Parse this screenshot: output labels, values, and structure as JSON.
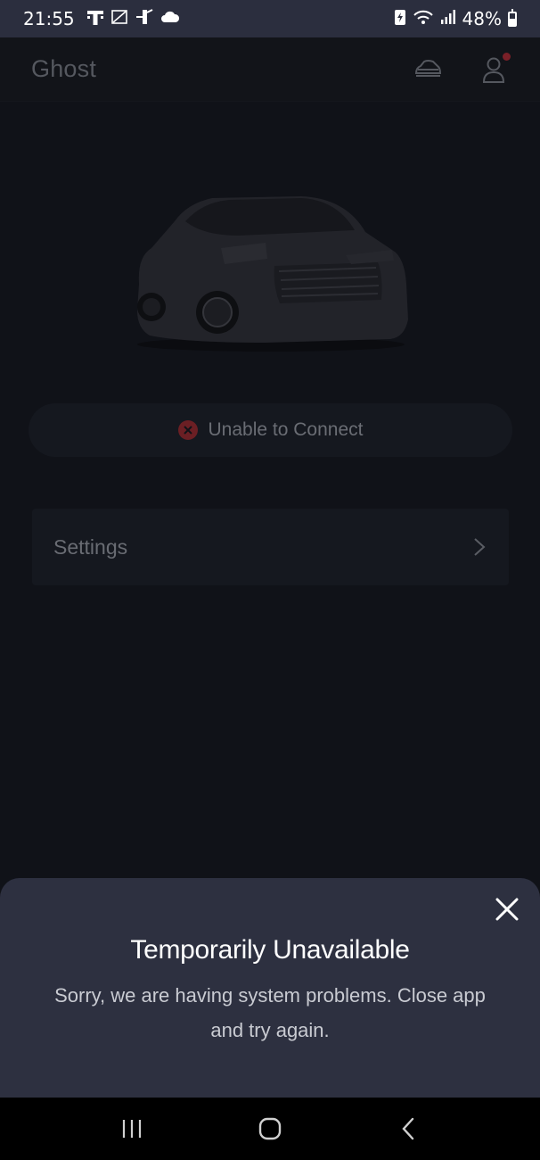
{
  "status_bar": {
    "time": "21:55",
    "left_icons": [
      "t-mobile-icon",
      "no-sim-icon",
      "usb-debug-icon",
      "cloud-icon"
    ],
    "right_icons": [
      "battery-saver-icon",
      "wifi-icon",
      "signal-icon"
    ],
    "battery_percent": "48%",
    "battery_level": 0.48
  },
  "header": {
    "vehicle_name": "Ghost",
    "icons": [
      "vehicle-icon",
      "account-icon"
    ]
  },
  "main": {
    "connection_status": "Unable to Connect",
    "settings_label": "Settings"
  },
  "sheet": {
    "title": "Temporarily Unavailable",
    "message": "Sorry, we are having system problems. Close app and try again."
  },
  "nav": {
    "buttons": [
      "recents-icon",
      "home-icon",
      "back-icon"
    ]
  },
  "colors": {
    "background": "#101218",
    "sheet": "#2d3040",
    "error": "#6b1f24"
  }
}
